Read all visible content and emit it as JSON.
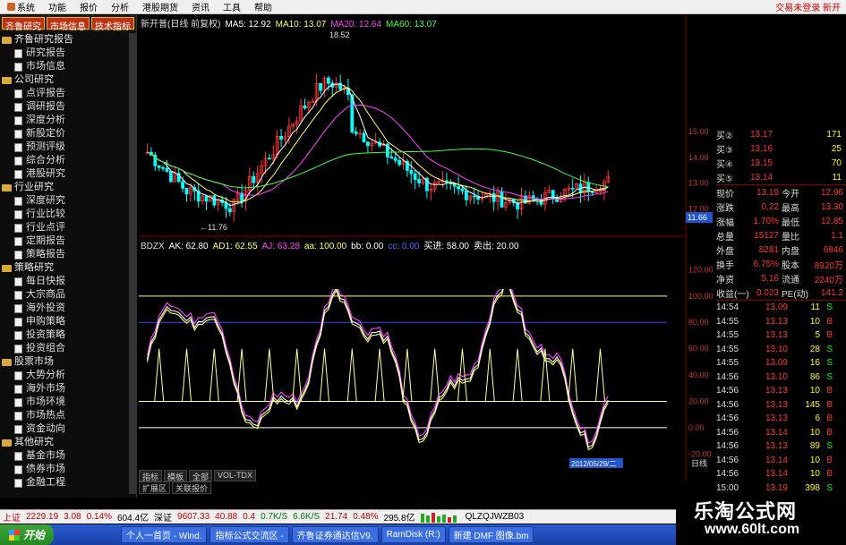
{
  "menubar": {
    "items": [
      "系统",
      "功能",
      "报价",
      "分析",
      "港股期货",
      "资讯",
      "工具",
      "帮助"
    ],
    "login": "交易未登录 新开"
  },
  "sidebar": {
    "tabs": [
      "齐鲁研究",
      "市场信息",
      "技术指标"
    ],
    "tree": [
      {
        "type": "cat",
        "label": "齐鲁研究报告"
      },
      {
        "type": "leaf",
        "label": "研究报告"
      },
      {
        "type": "leaf",
        "label": "市场信息"
      },
      {
        "type": "cat",
        "label": "公司研究"
      },
      {
        "type": "leaf",
        "label": "点评报告"
      },
      {
        "type": "leaf",
        "label": "调研报告"
      },
      {
        "type": "leaf",
        "label": "深度分析"
      },
      {
        "type": "leaf",
        "label": "新股定价"
      },
      {
        "type": "leaf",
        "label": "预测评级"
      },
      {
        "type": "leaf",
        "label": "综合分析"
      },
      {
        "type": "leaf",
        "label": "港股研究"
      },
      {
        "type": "cat",
        "label": "行业研究"
      },
      {
        "type": "leaf",
        "label": "深度研究"
      },
      {
        "type": "leaf",
        "label": "行业比较"
      },
      {
        "type": "leaf",
        "label": "行业点评"
      },
      {
        "type": "leaf",
        "label": "定期报告"
      },
      {
        "type": "leaf",
        "label": "策略报告"
      },
      {
        "type": "cat",
        "label": "策略研究"
      },
      {
        "type": "leaf",
        "label": "每日快报"
      },
      {
        "type": "leaf",
        "label": "大宗商品"
      },
      {
        "type": "leaf",
        "label": "海外投资"
      },
      {
        "type": "leaf",
        "label": "申购策略"
      },
      {
        "type": "leaf",
        "label": "投资策略"
      },
      {
        "type": "leaf",
        "label": "投资组合"
      },
      {
        "type": "cat",
        "label": "股票市场"
      },
      {
        "type": "leaf",
        "label": "大势分析"
      },
      {
        "type": "leaf",
        "label": "海外市场"
      },
      {
        "type": "leaf",
        "label": "市场环境"
      },
      {
        "type": "leaf",
        "label": "市场热点"
      },
      {
        "type": "leaf",
        "label": "资金动向"
      },
      {
        "type": "cat",
        "label": "其他研究"
      },
      {
        "type": "leaf",
        "label": "基金市场"
      },
      {
        "type": "leaf",
        "label": "债券市场"
      },
      {
        "type": "leaf",
        "label": "金融工程"
      }
    ]
  },
  "main_chart": {
    "header": [
      {
        "text": "新开普(日线 前复权)",
        "color": "#dddddd"
      },
      {
        "text": "MA5: 12.92",
        "color": "#ffffff"
      },
      {
        "text": "MA10: 13.07",
        "color": "#ffff66"
      },
      {
        "text": "MA20: 12.64",
        "color": "#ff44ff"
      },
      {
        "text": "MA60: 13.07",
        "color": "#44ff44"
      }
    ],
    "high_label": "18.52",
    "low_label": "11.76",
    "price_ticks": [
      "15.00",
      "14.00",
      "13.00",
      "12.00"
    ],
    "current_tag": "11.66"
  },
  "indicator": {
    "header": [
      {
        "text": "BDZX",
        "color": "#dddddd"
      },
      {
        "text": "AK: 62.80",
        "color": "#ffffff"
      },
      {
        "text": "AD1: 62.55",
        "color": "#ffff66"
      },
      {
        "text": "AJ: 63.28",
        "color": "#ff44ff"
      },
      {
        "text": "aa: 100.00",
        "color": "#ffff66"
      },
      {
        "text": "bb: 0.00",
        "color": "#ffffff"
      },
      {
        "text": "cc: 0.00",
        "color": "#4466ff"
      },
      {
        "text": "买进: 58.00",
        "color": "#ffffff"
      },
      {
        "text": "卖出: 20.00",
        "color": "#ffffff"
      }
    ],
    "ticks": [
      "120.00",
      "100.00",
      "80.00",
      "60.00",
      "40.00",
      "20.00",
      "0.00",
      "-20.00"
    ]
  },
  "quote": {
    "asks": [
      {
        "label": "买②",
        "price": "13.17",
        "vol": "171"
      },
      {
        "label": "买③",
        "price": "13.16",
        "vol": "25"
      },
      {
        "label": "买④",
        "price": "13.15",
        "vol": "70"
      },
      {
        "label": "买⑤",
        "price": "13.14",
        "vol": "11"
      }
    ],
    "stats": [
      {
        "l1": "现价",
        "v1": "13.19",
        "l2": "今开",
        "v2": "12.96"
      },
      {
        "l1": "涨跌",
        "v1": "0.22",
        "l2": "最高",
        "v2": "13.30"
      },
      {
        "l1": "涨幅",
        "v1": "1.70%",
        "l2": "最低",
        "v2": "12.85"
      },
      {
        "l1": "总量",
        "v1": "15127",
        "l2": "量比",
        "v2": "1.1"
      },
      {
        "l1": "外盘",
        "v1": "8281",
        "l2": "内盘",
        "v2": "6846"
      },
      {
        "l1": "换手",
        "v1": "6.75%",
        "l2": "股本",
        "v2": "8920万"
      },
      {
        "l1": "净资",
        "v1": "5.16",
        "l2": "流通",
        "v2": "2240万"
      },
      {
        "l1": "收益(一)",
        "v1": "0.023",
        "l2": "PE(动)",
        "v2": "141.2"
      }
    ],
    "trades": [
      {
        "time": "14:54",
        "price": "13.09",
        "vol": "11",
        "side": "S"
      },
      {
        "time": "14:55",
        "price": "13.13",
        "vol": "10",
        "side": "B"
      },
      {
        "time": "14:55",
        "price": "13.13",
        "vol": "5",
        "side": "B"
      },
      {
        "time": "14:55",
        "price": "13.10",
        "vol": "28",
        "side": "S"
      },
      {
        "time": "14:55",
        "price": "13.09",
        "vol": "16",
        "side": "S"
      },
      {
        "time": "14:56",
        "price": "13.10",
        "vol": "86",
        "side": "S"
      },
      {
        "time": "14:56",
        "price": "13.13",
        "vol": "10",
        "side": "B"
      },
      {
        "time": "14:56",
        "price": "13.13",
        "vol": "145",
        "side": "B"
      },
      {
        "time": "14:56",
        "price": "13.13",
        "vol": "6",
        "side": "B"
      },
      {
        "time": "14:56",
        "price": "13.14",
        "vol": "10",
        "side": "B"
      },
      {
        "time": "14:56",
        "price": "13.13",
        "vol": "89",
        "side": "S"
      },
      {
        "time": "14:56",
        "price": "13.14",
        "vol": "10",
        "side": "B"
      },
      {
        "time": "14:56",
        "price": "13.14",
        "vol": "10",
        "side": "B"
      },
      {
        "time": "15:00",
        "price": "13.19",
        "vol": "398",
        "side": "S"
      }
    ],
    "date_tag": "2012/05/29/二",
    "daily_tab": "日线"
  },
  "bottom_tabs": [
    "指标",
    "模板",
    "全部",
    "VOL-TDX"
  ],
  "bottom_tabs2": [
    "扩展区",
    "关联报价"
  ],
  "status": {
    "sh_label": "上证",
    "sh_value": "2229.19",
    "sh_change": "3.08",
    "sh_pct": "0.14%",
    "sh_amount": "604.4亿",
    "sz_label": "深证",
    "sz_value": "9607.33",
    "sz_change": "40.88",
    "sz_pct": "0.4",
    "speed1": "0.7K/S",
    "speed2": "6.6K/S",
    "cy_change": "21.74",
    "cy_pct": "0.48%",
    "cy_amount": "295.8亿",
    "code": "QLZQJWZB03"
  },
  "taskbar": {
    "start": "开始",
    "tasks": [
      "个人一首页 - Wind.",
      "指标公式交流区 -",
      "齐鲁证券通达信V9.",
      "RamDisk (R:)",
      "新建 DMF 图像.bm"
    ]
  },
  "watermark": {
    "title": "乐淘公式网",
    "url": "www.60lt.com"
  },
  "colors": {
    "up": "#ff3333",
    "down": "#00ffff",
    "ma5": "#ffffff",
    "ma10": "#ffff66",
    "ma20": "#ff44ff",
    "ma60": "#44ff44"
  }
}
